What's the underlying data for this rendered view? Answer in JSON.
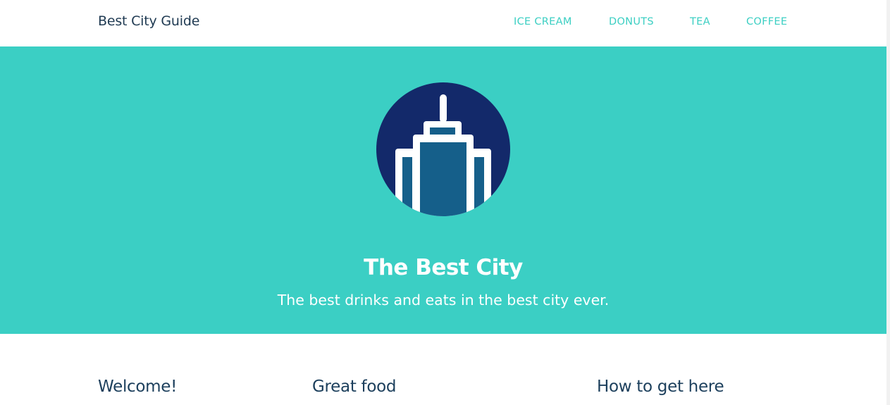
{
  "navbar": {
    "brand": "Best City Guide",
    "links": [
      "ICE CREAM",
      "DONUTS",
      "TEA",
      "COFFEE"
    ]
  },
  "hero": {
    "title": "The Best City",
    "subtitle": "The best drinks and eats in the best city ever.",
    "logo_icon": "city-building-icon",
    "background_color": "#3bcfc4",
    "circle_color": "#13296a",
    "building_color": "#155f8a"
  },
  "sections": [
    "Welcome!",
    "Great food",
    "How to get here"
  ],
  "colors": {
    "brand_text": "#1f3a52",
    "nav_link": "#3ccfc3",
    "heading": "#1c3f5c"
  }
}
